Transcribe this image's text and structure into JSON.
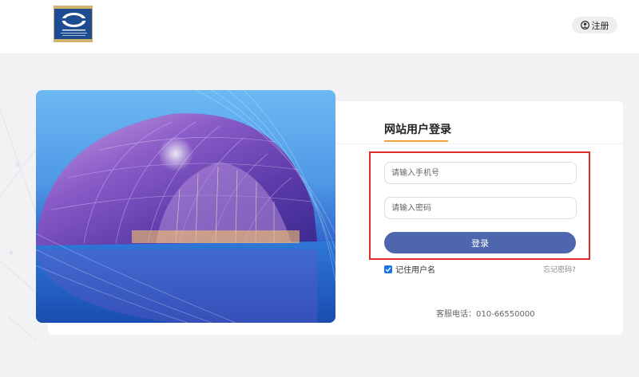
{
  "header": {
    "register_label": "注册"
  },
  "login": {
    "tab_title": "网站用户登录",
    "phone_placeholder": "请输入手机号",
    "password_placeholder": "请输入密码",
    "login_label": "登录",
    "remember_label": "记住用户名",
    "remember_checked": true,
    "forgot_label": "忘记密码?"
  },
  "footer": {
    "service_phone": "客服电话：010-66550000"
  },
  "colors": {
    "login_button": "#4d66ad",
    "highlight_border": "#e02b2b",
    "tab_underline": "#f0a23b"
  },
  "icons": {
    "register": "user-circle-icon",
    "logo": "logo"
  }
}
